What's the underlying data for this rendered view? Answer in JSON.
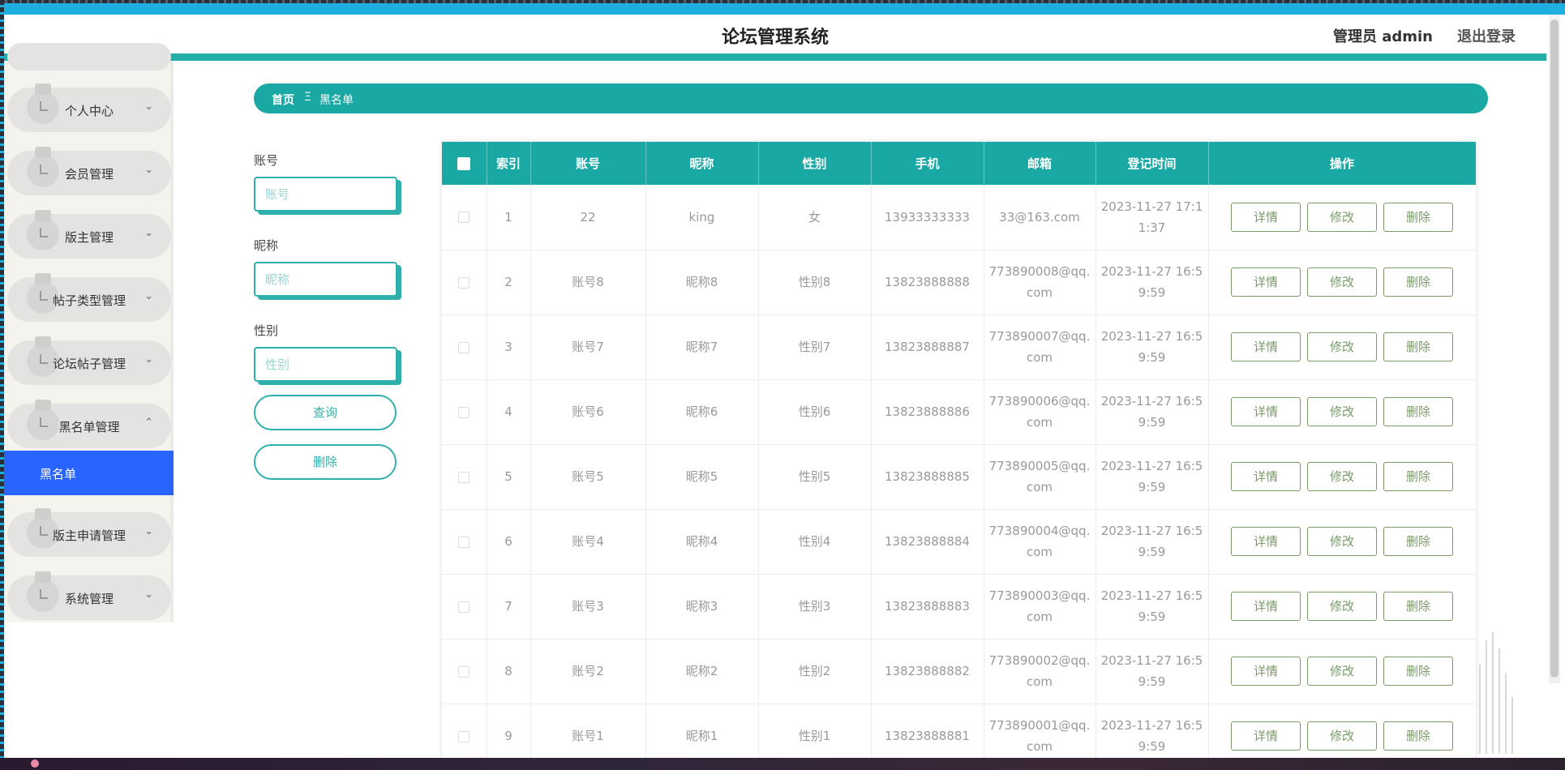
{
  "header": {
    "title": "论坛管理系统",
    "admin": "管理员 admin",
    "logout": "退出登录"
  },
  "sidebar": {
    "items": [
      {
        "label": "个人中心",
        "expanded": false
      },
      {
        "label": "会员管理",
        "expanded": false
      },
      {
        "label": "版主管理",
        "expanded": false
      },
      {
        "label": "帖子类型管理",
        "expanded": false
      },
      {
        "label": "论坛帖子管理",
        "expanded": false
      },
      {
        "label": "黑名单管理",
        "expanded": true
      },
      {
        "label": "版主申请管理",
        "expanded": false
      },
      {
        "label": "系统管理",
        "expanded": false
      }
    ],
    "active_sub": "黑名单",
    "chevron_down": "⌄",
    "chevron_up": "⌃"
  },
  "breadcrumb": {
    "home": "首页",
    "separator": "Ξ",
    "current": "黑名单"
  },
  "search": {
    "account_label": "账号",
    "account_placeholder": "账号",
    "nickname_label": "昵称",
    "nickname_placeholder": "昵称",
    "gender_label": "性别",
    "gender_placeholder": "性别",
    "query_button": "查询",
    "delete_button": "删除"
  },
  "table": {
    "columns": [
      "索引",
      "账号",
      "昵称",
      "性别",
      "手机",
      "邮箱",
      "登记时间",
      "操作"
    ],
    "actions": {
      "detail": "详情",
      "edit": "修改",
      "delete": "删除"
    },
    "rows": [
      {
        "index": "1",
        "account": "22",
        "nickname": "king",
        "gender": "女",
        "phone": "13933333333",
        "email": "33@163.com",
        "time": "2023-11-27 17:11:37"
      },
      {
        "index": "2",
        "account": "账号8",
        "nickname": "昵称8",
        "gender": "性别8",
        "phone": "13823888888",
        "email": "773890008@qq.com",
        "time": "2023-11-27 16:59:59"
      },
      {
        "index": "3",
        "account": "账号7",
        "nickname": "昵称7",
        "gender": "性别7",
        "phone": "13823888887",
        "email": "773890007@qq.com",
        "time": "2023-11-27 16:59:59"
      },
      {
        "index": "4",
        "account": "账号6",
        "nickname": "昵称6",
        "gender": "性别6",
        "phone": "13823888886",
        "email": "773890006@qq.com",
        "time": "2023-11-27 16:59:59"
      },
      {
        "index": "5",
        "account": "账号5",
        "nickname": "昵称5",
        "gender": "性别5",
        "phone": "13823888885",
        "email": "773890005@qq.com",
        "time": "2023-11-27 16:59:59"
      },
      {
        "index": "6",
        "account": "账号4",
        "nickname": "昵称4",
        "gender": "性别4",
        "phone": "13823888884",
        "email": "773890004@qq.com",
        "time": "2023-11-27 16:59:59"
      },
      {
        "index": "7",
        "account": "账号3",
        "nickname": "昵称3",
        "gender": "性别3",
        "phone": "13823888883",
        "email": "773890003@qq.com",
        "time": "2023-11-27 16:59:59"
      },
      {
        "index": "8",
        "account": "账号2",
        "nickname": "昵称2",
        "gender": "性别2",
        "phone": "13823888882",
        "email": "773890002@qq.com",
        "time": "2023-11-27 16:59:59"
      },
      {
        "index": "9",
        "account": "账号1",
        "nickname": "昵称1",
        "gender": "性别1",
        "phone": "13823888881",
        "email": "773890001@qq.com",
        "time": "2023-11-27 16:59:59"
      }
    ]
  },
  "colors": {
    "accent": "#1aa8a5",
    "active_menu": "#2a64ff",
    "action_border": "#7a9a6a"
  }
}
